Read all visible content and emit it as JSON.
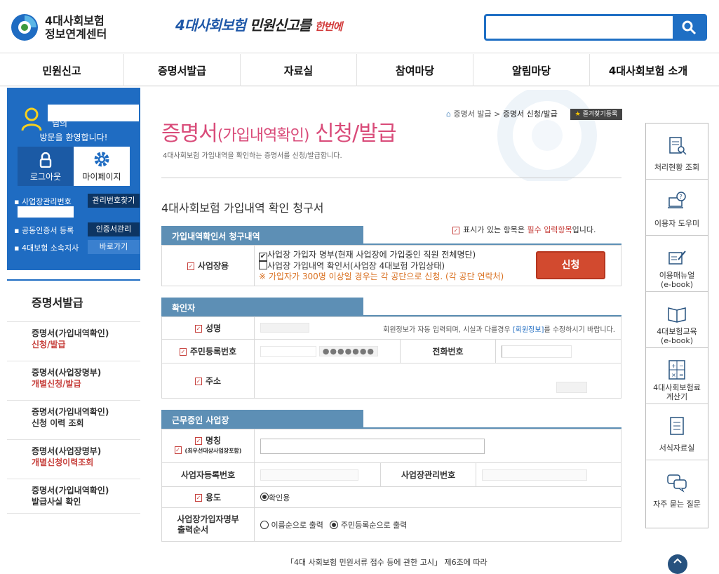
{
  "header": {
    "logo_line1": "4대사회보험",
    "logo_line2": "정보연계센터",
    "slogan_part1": "4대사회보험",
    "slogan_part2": "민원신고를",
    "slogan_part3": "한번에",
    "search_placeholder": ""
  },
  "gnb": [
    "민원신고",
    "증명서발급",
    "자료실",
    "참여마당",
    "알림마당",
    "4대사회보험 소개"
  ],
  "user": {
    "name_suffix": "님의",
    "welcome": "방문을 환영합니다!",
    "logout": "로그아웃",
    "mypage": "마이페이지",
    "biz_mgmt_no": "사업장관리번호",
    "find_mgmt_no": "관리번호찾기",
    "cert_register": "공동인증서 등록",
    "cert_manage": "인증서관리",
    "branch": "4대보험 소속지사",
    "go": "바로가기"
  },
  "side": {
    "title": "증명서발급",
    "items": [
      {
        "line1": "증명서(가입내역확인)",
        "line2": "신청/발급"
      },
      {
        "line1": "증명서(사업장명부)",
        "line2": "개별신청/발급"
      },
      {
        "line1": "증명서(가입내역확인)",
        "line2": "신청 이력 조회"
      },
      {
        "line1": "증명서(사업장명부)",
        "line2": "개별신청이력조회"
      },
      {
        "line1": "증명서(가입내역확인)",
        "line2": "발급사실 확인"
      }
    ]
  },
  "page": {
    "title_a": "증명서",
    "title_b": "(가입내역확인)",
    "title_c": " 신청/발급",
    "subtitle": "4대사회보험 가입내역을 확인하는 증명서를 신청/발급합니다.",
    "crumb1": "증명서 발급",
    "crumb2": "증명서 신청/발급",
    "favorite": "즐겨찾기등록",
    "form_title": "4대사회보험 가입내역 확인 청구서",
    "required_note_a": "표시가 있는 항목은 ",
    "required_note_b": "필수 입력항목",
    "required_note_c": "입니다."
  },
  "sec1": {
    "head": "가입내역확인서 청구내역",
    "label": "사업장용",
    "opt1": "사업장 가입자 명부(현재 사업장에 가입중인 직원 전체명단)",
    "opt2": "사업장 가입내역 확인서(사업장 4대보험 가입상태)",
    "warn": "※ 가입자가 300명 이상일 경우는 각 공단으로 신청. (각 공단 연락처)",
    "apply": "신청",
    "opt1_checked": true,
    "opt2_checked": false
  },
  "sec2": {
    "head": "확인자",
    "name": "성명",
    "name_note_a": "회원정보가 자동 입력되며, 시실과 다를경우 ",
    "name_note_b": "[회원정보]",
    "name_note_c": "를 수정하시기 바랍니다.",
    "rrn": "주민등록번호",
    "rrn_mask": "●●●●●●●",
    "phone": "전화번호",
    "addr": "주소"
  },
  "sec3": {
    "head": "근무중인 사업장",
    "name": "명칭",
    "name_sub": "(최우선대상사업장포함)",
    "biz_reg_no": "사업자등록번호",
    "biz_mgmt_no": "사업장관리번호",
    "usage": "용도",
    "usage_opt": "확인용",
    "order_label_1": "사업장가입자명부",
    "order_label_2": "출력순서",
    "order_opt1": "이름순으로 출력",
    "order_opt2": "주민등록순으로 출력"
  },
  "quick": [
    {
      "icon": "clipboard-search-icon",
      "label1": "처리현황 조회",
      "label2": ""
    },
    {
      "icon": "laptop-help-icon",
      "label1": "이용자 도우미",
      "label2": ""
    },
    {
      "icon": "pencil-note-icon",
      "label1": "이용매뉴얼",
      "label2": "(e-book)"
    },
    {
      "icon": "open-book-icon",
      "label1": "4대보험교육",
      "label2": "(e-book)"
    },
    {
      "icon": "calculator-icon",
      "label1": "4대사회보험료",
      "label2": "계산기"
    },
    {
      "icon": "document-list-icon",
      "label1": "서식자료실",
      "label2": ""
    },
    {
      "icon": "chat-bubbles-icon",
      "label1": "자주 묻는 질문",
      "label2": ""
    }
  ],
  "bottom_note": "「4대 사회보험 민원서류 접수 등에 관한 고시」 제6조에 따라",
  "colors": {
    "primary": "#1f6cc2",
    "section": "#5d8fb5",
    "title": "#d94b79",
    "apply": "#d24a2f",
    "required": "#c7423e"
  }
}
